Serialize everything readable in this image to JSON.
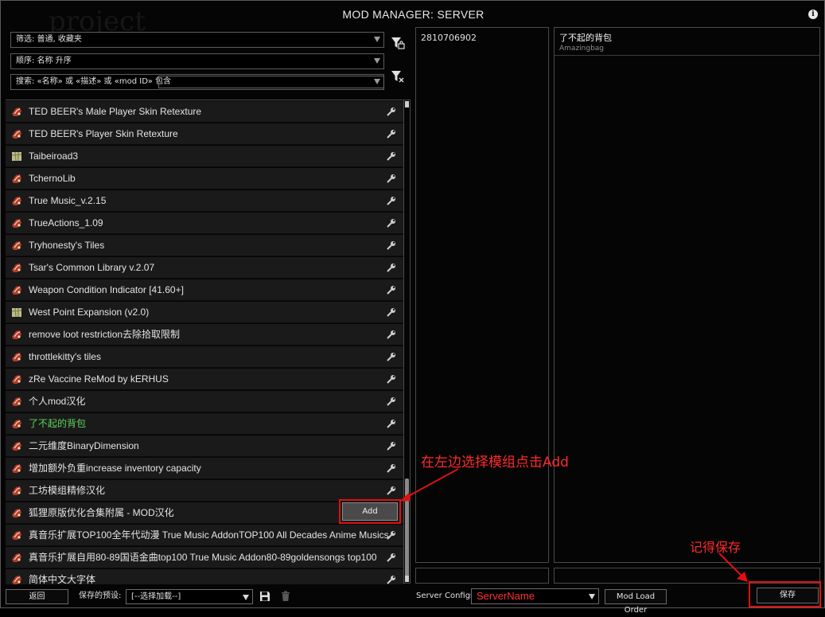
{
  "window": {
    "title": "MOD MANAGER: SERVER"
  },
  "filters": {
    "filter_label": "筛选: 普通, 收藏夹",
    "order_label": "顺序: 名称 升序",
    "search_label": "搜索: «名称» 或 «描述» 或 «mod ID» 包含",
    "search_value": ""
  },
  "mods": [
    {
      "name": "TED BEER's Male Player Skin Retexture",
      "icon": "steam-mod-icon"
    },
    {
      "name": "TED BEER's Player Skin Retexture",
      "icon": "steam-mod-icon"
    },
    {
      "name": "Taibeiroad3",
      "icon": "map-mod-icon"
    },
    {
      "name": "TchernoLib",
      "icon": "steam-mod-icon"
    },
    {
      "name": "True Music_v.2.15",
      "icon": "steam-mod-icon"
    },
    {
      "name": "TrueActions_1.09",
      "icon": "steam-mod-icon"
    },
    {
      "name": "Tryhonesty's Tiles",
      "icon": "steam-mod-icon"
    },
    {
      "name": "Tsar's Common Library v.2.07",
      "icon": "steam-mod-icon"
    },
    {
      "name": "Weapon Condition Indicator [41.60+]",
      "icon": "steam-mod-icon"
    },
    {
      "name": "West Point Expansion (v2.0)",
      "icon": "map-mod-icon"
    },
    {
      "name": "remove loot restriction去除拾取限制",
      "icon": "steam-mod-icon"
    },
    {
      "name": "throttlekitty's tiles",
      "icon": "steam-mod-icon"
    },
    {
      "name": "zRe Vaccine ReMod by kERHUS",
      "icon": "steam-mod-icon"
    },
    {
      "name": "个人mod汉化",
      "icon": "steam-mod-icon"
    },
    {
      "name": "了不起的背包",
      "icon": "steam-mod-icon",
      "active": true
    },
    {
      "name": "二元维度BinaryDimension",
      "icon": "steam-mod-icon"
    },
    {
      "name": "增加额外负重increase inventory capacity",
      "icon": "steam-mod-icon"
    },
    {
      "name": "工坊模组精修汉化",
      "icon": "steam-mod-icon"
    },
    {
      "name": "狐狸原版优化合集附属 - MOD汉化",
      "icon": "steam-mod-icon"
    },
    {
      "name": "真音乐扩展TOP100全年代动漫 True Music AddonTOP100 All Decades Anime Musics",
      "icon": "steam-mod-icon"
    },
    {
      "name": "真音乐扩展自用80-89国语金曲top100 True Music Addon80-89goldensongs top100",
      "icon": "steam-mod-icon"
    },
    {
      "name": "简体中文大字体",
      "icon": "steam-mod-icon"
    }
  ],
  "add_button": "Add",
  "server_mod_ids": [
    "2810706902"
  ],
  "detail": {
    "title": "了不起的背包",
    "subtitle": "Amazingbag"
  },
  "bottom": {
    "back": "返回",
    "preset_label": "保存的预设:",
    "preset_value": "[--选择加载--]",
    "server_configs_label": "Server Configs:",
    "server_name": "ServerName",
    "mod_load_order": "Mod Load Order",
    "save": "保存"
  },
  "annotations": {
    "add_hint": "在左边选择模组点击Add",
    "save_hint": "记得保存"
  },
  "colors": {
    "annotation_red": "#e01010",
    "active_mod_green": "#5cd65c"
  }
}
